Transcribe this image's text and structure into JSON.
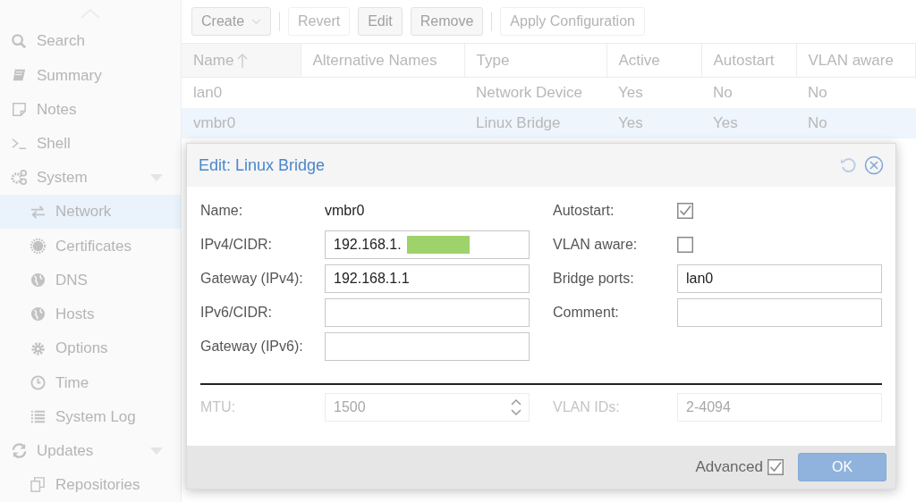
{
  "sidebar": {
    "items": [
      {
        "label": "Search",
        "selected": false
      },
      {
        "label": "Summary",
        "selected": false
      },
      {
        "label": "Notes",
        "selected": false
      },
      {
        "label": "Shell",
        "selected": false
      },
      {
        "label": "System",
        "selected": false,
        "expanded": true,
        "children": [
          {
            "label": "Network",
            "selected": true
          },
          {
            "label": "Certificates",
            "selected": false
          },
          {
            "label": "DNS",
            "selected": false
          },
          {
            "label": "Hosts",
            "selected": false
          },
          {
            "label": "Options",
            "selected": false
          },
          {
            "label": "Time",
            "selected": false
          },
          {
            "label": "System Log",
            "selected": false
          }
        ]
      },
      {
        "label": "Updates",
        "selected": false,
        "expanded": true,
        "children": [
          {
            "label": "Repositories",
            "selected": false
          }
        ]
      }
    ]
  },
  "toolbar": {
    "buttons": [
      {
        "label": "Create",
        "disabled": false,
        "menu": true
      },
      {
        "label": "Revert",
        "disabled": true,
        "separator_before": true
      },
      {
        "label": "Edit",
        "disabled": false
      },
      {
        "label": "Remove",
        "disabled": false
      },
      {
        "label": "Apply Configuration",
        "disabled": true,
        "separator_before": true
      }
    ]
  },
  "table": {
    "columns": [
      {
        "label": "Name",
        "sorted": true
      },
      {
        "label": "Alternative Names",
        "sorted": false
      },
      {
        "label": "Type",
        "sorted": false
      },
      {
        "label": "Active",
        "sorted": false
      },
      {
        "label": "Autostart",
        "sorted": false
      },
      {
        "label": "VLAN aware",
        "sorted": false
      }
    ],
    "rows": [
      {
        "selected": false,
        "cells": [
          "lan0",
          "",
          "Network Device",
          "Yes",
          "No",
          "No"
        ]
      },
      {
        "selected": true,
        "cells": [
          "vmbr0",
          "",
          "Linux Bridge",
          "Yes",
          "Yes",
          "No"
        ]
      }
    ]
  },
  "dialog": {
    "title": "Edit: Linux Bridge",
    "left_fields": [
      {
        "kind": "display",
        "label": "Name:",
        "value": "vmbr0"
      },
      {
        "kind": "input",
        "label": "IPv4/CIDR:",
        "value": "192.168.1.",
        "redacted": true
      },
      {
        "kind": "input",
        "label": "Gateway (IPv4):",
        "value": "192.168.1.1"
      },
      {
        "kind": "input",
        "label": "IPv6/CIDR:"
      },
      {
        "kind": "input",
        "label": "Gateway (IPv6):"
      }
    ],
    "right_fields": [
      {
        "kind": "checkbox",
        "label": "Autostart:",
        "checked": true
      },
      {
        "kind": "checkbox",
        "label": "VLAN aware:",
        "checked": false
      },
      {
        "kind": "input",
        "label": "Bridge ports:",
        "value": "lan0"
      },
      {
        "kind": "input",
        "label": "Comment:"
      }
    ],
    "advanced_fields": [
      {
        "kind": "spinner",
        "label": "MTU:",
        "placeholder": "1500",
        "disabled": true
      },
      {
        "kind": "input",
        "label": "VLAN IDs:",
        "placeholder": "2-4094",
        "disabled": true
      }
    ],
    "advanced": {
      "label": "Advanced",
      "checked": true
    },
    "ok": {
      "label": "OK",
      "disabled": true
    }
  }
}
